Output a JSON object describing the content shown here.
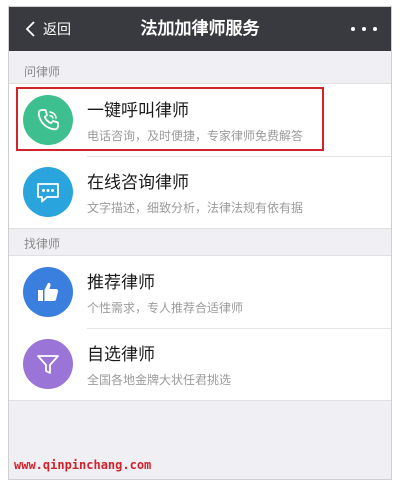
{
  "navbar": {
    "back_label": "返回",
    "title": "法加加律师服务"
  },
  "sections": [
    {
      "label": "问律师",
      "items": [
        {
          "title": "一键呼叫律师",
          "desc": "电话咨询，及时便捷，专家律师免费解答",
          "icon": "phone-icon",
          "color": "#3dbf8f"
        },
        {
          "title": "在线咨询律师",
          "desc": "文字描述，细致分析，法律法规有依有据",
          "icon": "chat-bubble-icon",
          "color": "#2aa4dc"
        }
      ]
    },
    {
      "label": "找律师",
      "items": [
        {
          "title": "推荐律师",
          "desc": "个性需求，专人推荐合适律师",
          "icon": "thumbs-up-icon",
          "color": "#3b7fde"
        },
        {
          "title": "自选律师",
          "desc": "全国各地金牌大状任君挑选",
          "icon": "filter-funnel-icon",
          "color": "#9a74d6"
        }
      ]
    }
  ],
  "watermark": "www.qinpinchang.com",
  "colors": {
    "navbar": "#393a3f",
    "highlight": "#d3232a",
    "background": "#efeff4"
  }
}
